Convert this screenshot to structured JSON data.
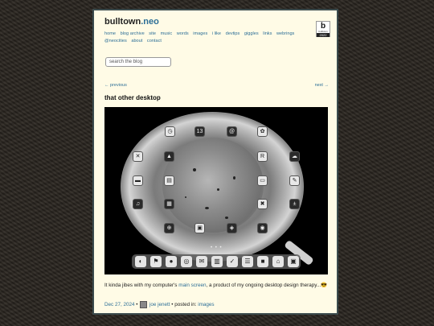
{
  "site": {
    "title_main": "bulltown",
    "title_tld": ".neo",
    "badge": {
      "letter": "b",
      "name": "bulltown",
      "year": "2022"
    }
  },
  "nav": {
    "items": [
      "home",
      "blog archive",
      "site",
      "music",
      "words",
      "images",
      "i like",
      "devtips",
      "giggles",
      "links",
      "webrings",
      "@neocities",
      "about",
      "contact"
    ]
  },
  "search": {
    "placeholder": "search the blog"
  },
  "pager": {
    "prev": "← previous",
    "next": "next →"
  },
  "post": {
    "title": "that other desktop",
    "caption_before": "It kinda jibes with my computer's ",
    "caption_link": "main screen",
    "caption_after": ", a product of my ongoing desktop design therapy...😎",
    "date": "Dec 27, 2024",
    "author": "joe jenett",
    "posted_in_label": "• posted in:",
    "category": "images"
  },
  "screenshot": {
    "page_indicator": "• • •",
    "apps_left": [
      "wallet-icon",
      "x-icon",
      "folder-icon",
      "note-icon",
      "music-icon",
      "plus-icon"
    ],
    "apps_top": [
      "clock-icon",
      "calendar-icon",
      "spiral-icon",
      "flower-icon"
    ],
    "apps_right": [
      "cloud-icon",
      "notes-icon",
      "calculator-icon",
      "close-icon",
      "fox-icon"
    ],
    "calendar_day": "13",
    "dock": [
      "◐",
      "⚑",
      "●",
      "◎",
      "✉",
      "▥",
      "✓",
      "☰",
      "■",
      "⌂",
      "▣"
    ]
  },
  "colors": {
    "link": "#2d6f97",
    "page_bg": "#fffbe6",
    "border": "#3b4b4d"
  }
}
